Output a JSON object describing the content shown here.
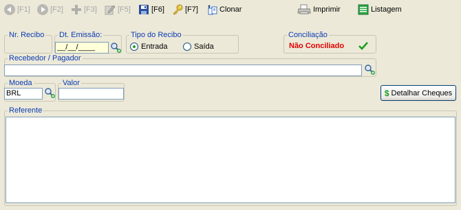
{
  "toolbar": {
    "first": "[F1]",
    "prev": "[F2]",
    "new": "[F3]",
    "edit": "[F5]",
    "save": "[F6]",
    "search": "[F7]",
    "clone": "Clonar",
    "print": "Imprimir",
    "list": "Listagem"
  },
  "form": {
    "nr_recibo": {
      "label": "Nr. Recibo",
      "value": ""
    },
    "dt_emissao": {
      "label": "Dt. Emissão:",
      "value": "__/__/____"
    },
    "tipo_recibo": {
      "label": "Tipo do Recibo",
      "options": [
        "Entrada",
        "Saída"
      ],
      "selected": "Entrada"
    },
    "conciliacao": {
      "label": "Conciliação",
      "status": "Não Conciliado"
    },
    "recebedor": {
      "label": "Recebedor / Pagador",
      "value": ""
    },
    "moeda": {
      "label": "Moeda",
      "value": "BRL"
    },
    "valor": {
      "label": "Valor",
      "value": ""
    },
    "detalhar_button": "Detalhar Cheques",
    "referente": {
      "label": "Referente",
      "value": ""
    }
  },
  "colors": {
    "legend": "#0a3bb3",
    "status_red": "#e00000",
    "check_green": "#1a9c1a"
  }
}
